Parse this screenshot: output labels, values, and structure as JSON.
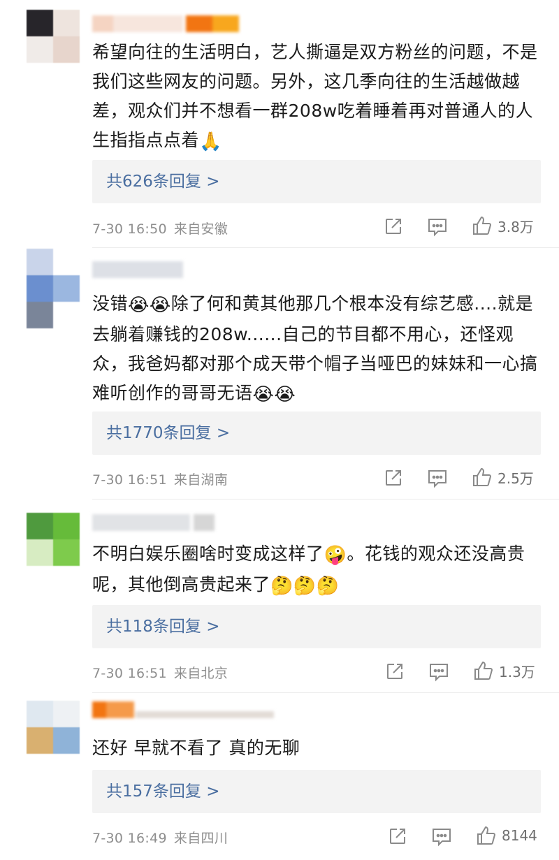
{
  "comments": [
    {
      "text": "希望向往的生活明白，艺人撕逼是双方粉丝的问题，不是我们这些网友的问题。另外，这几季向往的生活越做越差，观众们并不想看一群208w吃着睡着再对普通人的人生指指点点着",
      "trail_emoji": "🙏",
      "replies_label": "共626条回复 >",
      "date": "7-30 16:50",
      "location": "来自安徽",
      "likes": "3.8万"
    },
    {
      "text_parts": [
        "没错",
        "除了何和黄其他那几个根本没有综艺感....就是去躺着赚钱的208w......自己的节目都不用心，还怪观众，我爸妈都对那个成天带个帽子当哑巴的妹妹和一心搞难听创作的哥哥无语"
      ],
      "inline_emoji": "😭😭",
      "trail_emoji": "😭😭",
      "replies_label": "共1770条回复 >",
      "date": "7-30 16:51",
      "location": "来自湖南",
      "likes": "2.5万"
    },
    {
      "text_parts": [
        "不明白娱乐圈啥时变成这样了",
        "。花钱的观众还没高贵呢，其他倒高贵起来了"
      ],
      "inline_emoji": "🤪",
      "trail_emoji": "🤔🤔🤔",
      "replies_label": "共118条回复 >",
      "date": "7-30 16:51",
      "location": "来自北京",
      "likes": "1.3万"
    },
    {
      "text": "还好 早就不看了 真的无聊",
      "replies_label": "共157条回复 >",
      "date": "7-30 16:49",
      "location": "来自四川",
      "likes": "8144"
    }
  ],
  "icons": {
    "share": "share-icon",
    "comment": "comment-icon",
    "like": "like-icon"
  }
}
